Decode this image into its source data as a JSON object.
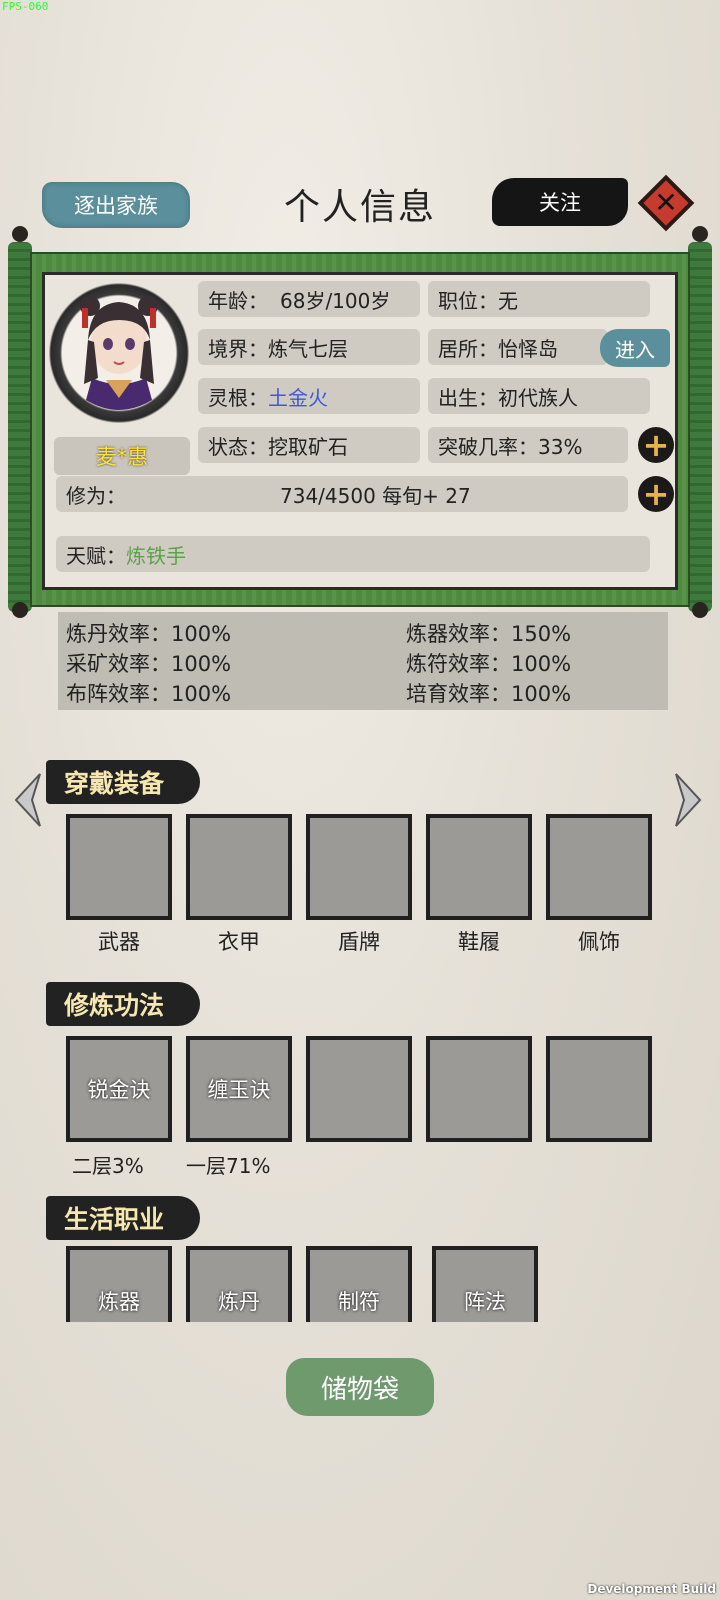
{
  "debug": {
    "fps": "FPS-060",
    "build": "Development Build"
  },
  "header": {
    "expel_label": "逐出家族",
    "title": "个人信息",
    "follow_label": "关注"
  },
  "character": {
    "name": "麦*惠",
    "age_label": "年龄：",
    "age_value": "68岁/100岁",
    "position": "职位：无",
    "realm": "境界：炼气七层",
    "residence": "居所：怡怿岛",
    "enter_label": "进入",
    "root_label": "灵根：",
    "root_value": "土金火",
    "origin": "出生：初代族人",
    "status": "状态：挖取矿石",
    "breakthrough": "突破几率：33%",
    "cultivation_label": "修为：",
    "cultivation_value": "734/4500  每旬+ 27",
    "talent_label": "天赋：",
    "talent_value": "炼铁手"
  },
  "efficiency": [
    "炼丹效率：100%",
    "炼器效率：150%",
    "采矿效率：100%",
    "炼符效率：100%",
    "布阵效率：100%",
    "培育效率：100%"
  ],
  "sections": {
    "equipment": "穿戴装备",
    "techniques": "修炼功法",
    "professions": "生活职业"
  },
  "equipment_slots": [
    "武器",
    "衣甲",
    "盾牌",
    "鞋履",
    "佩饰"
  ],
  "techniques": [
    {
      "name": "锐金诀",
      "level": "二层3%"
    },
    {
      "name": "缠玉诀",
      "level": "一层71%"
    },
    {
      "name": "",
      "level": ""
    },
    {
      "name": "",
      "level": ""
    },
    {
      "name": "",
      "level": ""
    }
  ],
  "professions": [
    "炼器",
    "炼丹",
    "制符",
    "阵法"
  ],
  "bag_label": "储物袋",
  "colors": {
    "accent_teal": "#5a8f9b",
    "scroll_green": "#4f8b3e",
    "root_blue": "#3b5bd6",
    "talent_green": "#5fa04a",
    "name_yellow": "#ffe23a"
  }
}
